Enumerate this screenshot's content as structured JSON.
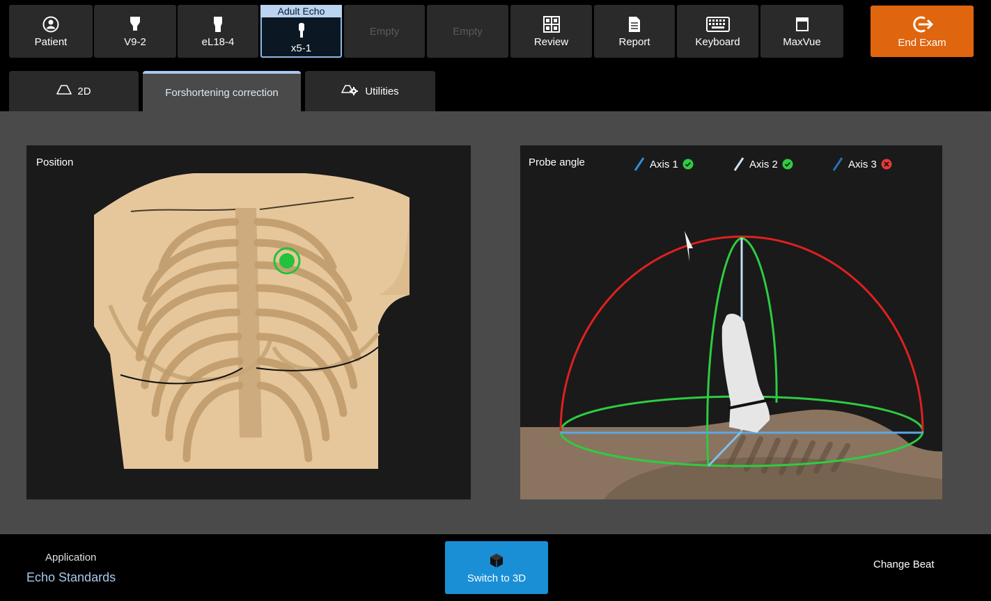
{
  "toolbar": {
    "patient": "Patient",
    "v9": "V9-2",
    "el18": "eL18-4",
    "active_header": "Adult Echo",
    "x5": "x5-1",
    "empty1": "Empty",
    "empty2": "Empty",
    "review": "Review",
    "report": "Report",
    "keyboard": "Keyboard",
    "maxvue": "MaxVue",
    "end_exam": "End Exam"
  },
  "tabs": {
    "tab_2d": "2D",
    "tab_fc": "Forshortening correction",
    "tab_util": "Utilities"
  },
  "position_panel": {
    "title": "Position"
  },
  "probe_panel": {
    "title": "Probe angle",
    "axes": [
      {
        "label": "Axis 1",
        "status": "ok"
      },
      {
        "label": "Axis 2",
        "status": "ok"
      },
      {
        "label": "Axis 3",
        "status": "error"
      }
    ]
  },
  "bottom": {
    "app_label": "Application",
    "app_value": "Echo Standards",
    "switch_3d": "Switch to 3D",
    "change_beat": "Change Beat"
  },
  "colors": {
    "accent_orange": "#e0650f",
    "accent_blue": "#1a8fd6",
    "ok_green": "#2ecc40",
    "error_red": "#e53935"
  }
}
